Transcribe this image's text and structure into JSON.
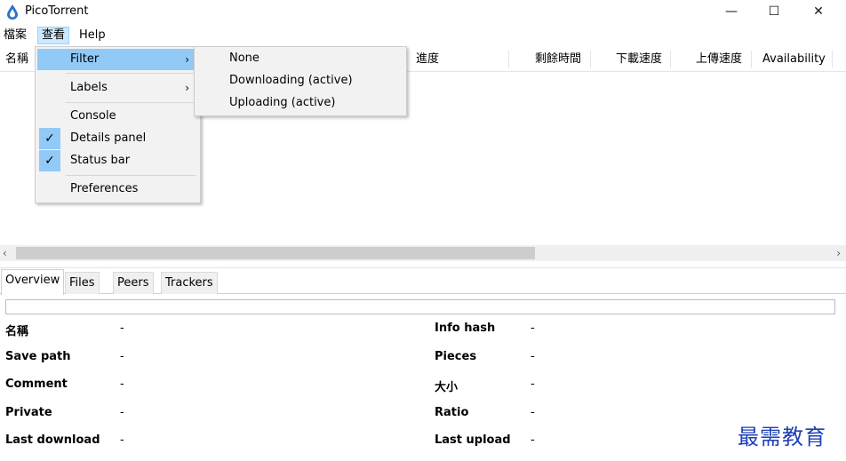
{
  "window": {
    "title": "PicoTorrent",
    "controls": {
      "minimize": "—",
      "maximize": "☐",
      "close": "✕"
    }
  },
  "menubar": {
    "file": "檔案",
    "view": "查看",
    "help": "Help"
  },
  "list": {
    "columns": [
      "名稱",
      "進度",
      "剩餘時間",
      "下載速度",
      "上傳速度",
      "Availability"
    ]
  },
  "view_menu": {
    "items": [
      {
        "label": "Filter",
        "submenu": true,
        "highlighted": true
      },
      {
        "label": "Labels",
        "submenu": true
      },
      {
        "label": "Console"
      },
      {
        "label": "Details panel",
        "checked": true
      },
      {
        "label": "Status bar",
        "checked": true
      },
      {
        "label": "Preferences"
      }
    ],
    "submenu_arrow": "›",
    "check_mark": "✓"
  },
  "filter_menu": {
    "items": [
      "None",
      "Downloading (active)",
      "Uploading (active)"
    ]
  },
  "scrollbar": {
    "left_arrow": "‹",
    "right_arrow": "›"
  },
  "details": {
    "tabs": [
      "Overview",
      "Files",
      "Peers",
      "Trackers"
    ],
    "active_tab": "Overview",
    "left_props": [
      {
        "label": "名稱",
        "value": "-"
      },
      {
        "label": "Save path",
        "value": "-"
      },
      {
        "label": "Comment",
        "value": "-"
      },
      {
        "label": "Private",
        "value": "-"
      },
      {
        "label": "Last download",
        "value": "-"
      }
    ],
    "right_props": [
      {
        "label": "Info hash",
        "value": "-"
      },
      {
        "label": "Pieces",
        "value": "-"
      },
      {
        "label": "大小",
        "value": "-"
      },
      {
        "label": "Ratio",
        "value": "-"
      },
      {
        "label": "Last upload",
        "value": "-"
      }
    ]
  },
  "watermark": "最需教育",
  "colors": {
    "menu_highlight": "#91c9f7",
    "menu_bar_active": "#cce8ff",
    "watermark": "#1d3fb8",
    "app_icon": "#2b73c9"
  }
}
